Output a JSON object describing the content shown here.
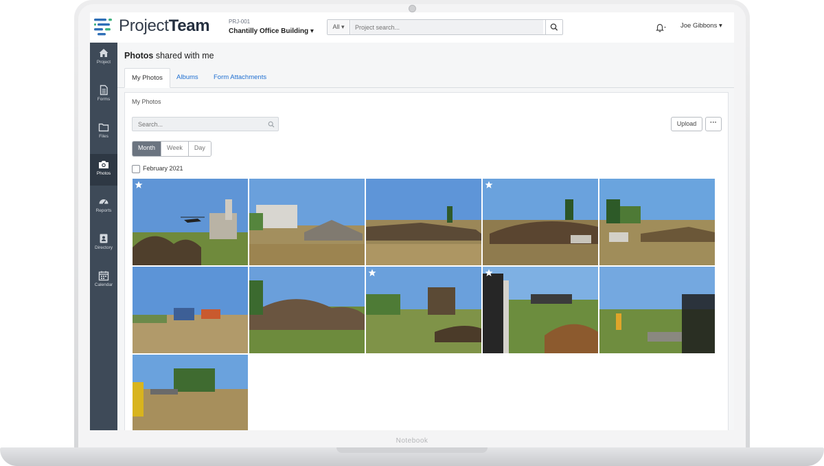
{
  "app": {
    "brand_light": "Project",
    "brand_bold": "Team"
  },
  "project": {
    "code": "PRJ-001",
    "name": "Chantilly Office Building ▾"
  },
  "search": {
    "scope": "All ▾",
    "placeholder": "Project search..."
  },
  "user": {
    "name": "Joe Gibbons ▾"
  },
  "device": {
    "label": "Notebook"
  },
  "sidebar": {
    "items": [
      {
        "label": "Project",
        "icon": "home-icon"
      },
      {
        "label": "Forms",
        "icon": "document-icon"
      },
      {
        "label": "Files",
        "icon": "folder-icon"
      },
      {
        "label": "Photos",
        "icon": "camera-icon",
        "active": true
      },
      {
        "label": "Reports",
        "icon": "gauge-icon"
      },
      {
        "label": "Directory",
        "icon": "contact-card-icon"
      },
      {
        "label": "Calendar",
        "icon": "calendar-icon"
      }
    ]
  },
  "page": {
    "title_bold": "Photos",
    "title_rest": " shared with me"
  },
  "tabs": [
    {
      "label": "My Photos",
      "active": true
    },
    {
      "label": "Albums"
    },
    {
      "label": "Form Attachments"
    }
  ],
  "panel": {
    "title": "My Photos",
    "search_placeholder": "Search...",
    "upload_label": "Upload",
    "more_label": "···",
    "views": [
      {
        "label": "Month",
        "active": true
      },
      {
        "label": "Week"
      },
      {
        "label": "Day"
      }
    ],
    "group_label": "February 2021"
  },
  "colors": {
    "sidebar": "#3e4a58",
    "sidebar_active": "#2e3844",
    "accent": "#f0b429",
    "link": "#1f6fd1",
    "logo_blue": "#2f6fb7",
    "logo_green": "#3fb27f"
  },
  "photos": [
    {
      "starred": true
    },
    {
      "starred": false
    },
    {
      "starred": false
    },
    {
      "starred": true
    },
    {
      "starred": false
    },
    {
      "starred": false
    },
    {
      "starred": false
    },
    {
      "starred": true
    },
    {
      "starred": true
    },
    {
      "starred": false
    },
    {
      "starred": false
    }
  ]
}
